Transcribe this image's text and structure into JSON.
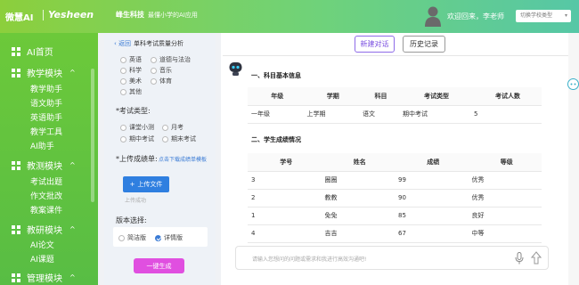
{
  "header": {
    "brand_left": "微慧AI",
    "brand_name": "Yesheen",
    "brand_cn": "峰生科技",
    "tagline": "最懂小学的AI应用",
    "welcome": "欢迎回来，李老师",
    "switch_label": "切换学校类型"
  },
  "sidebar": {
    "home": "AI首页",
    "teaching_module": "教学模块",
    "teaching_items": [
      "教学助手",
      "语文助手",
      "英语助手",
      "教学工具",
      "AI助手"
    ],
    "research_module": "教测模块",
    "research_items": [
      "考试出题",
      "作文批改",
      "教案课件"
    ],
    "study_module": "教研模块",
    "study_items": [
      "AI论文",
      "AI课题"
    ],
    "manage_module": "管理模块"
  },
  "left_panel": {
    "back": "返回",
    "title": "单科考试质量分析",
    "subjects": [
      "英语",
      "道德与法治",
      "科学",
      "音乐",
      "美术",
      "体育",
      "其他"
    ],
    "exam_type_label": "*考试类型:",
    "exam_types": [
      "课堂小测",
      "月考",
      "期中考试",
      "期末考试"
    ],
    "upload_label": "*上传成绩单:",
    "template_link": "点击下载成绩单模板",
    "upload_button": "上传文件",
    "upload_status": "上传成功",
    "version_label": "版本选择:",
    "versions": [
      "简洁版",
      "详情版"
    ],
    "selected_version": "详情版",
    "generate_button": "一键生成"
  },
  "toolbar": {
    "new_chat": "新建对话",
    "history": "历史记录"
  },
  "report": {
    "section1": "一、科目基本信息",
    "table1_headers": [
      "年级",
      "学期",
      "科目",
      "考试类型",
      "考试人数"
    ],
    "table1_row": [
      "一年级",
      "上学期",
      "语文",
      "期中考试",
      "5"
    ],
    "section2": "二、学生成绩情况",
    "table2_headers": [
      "学号",
      "姓名",
      "成绩",
      "等级"
    ],
    "table2_rows": [
      [
        "3",
        "圈圈",
        "99",
        "优秀"
      ],
      [
        "2",
        "教教",
        "90",
        "优秀"
      ],
      [
        "1",
        "免免",
        "85",
        "良好"
      ],
      [
        "4",
        "吉吉",
        "67",
        "中等"
      ]
    ]
  },
  "composer": {
    "placeholder": "请输入您想问的问题或需求和我进行高效沟通吧!"
  },
  "colors": {
    "sidebar_green": "#6cc93a",
    "accent_blue": "#2f7fe0",
    "accent_purple": "#7a4fe0",
    "generate_pink": "#e04fe0"
  }
}
